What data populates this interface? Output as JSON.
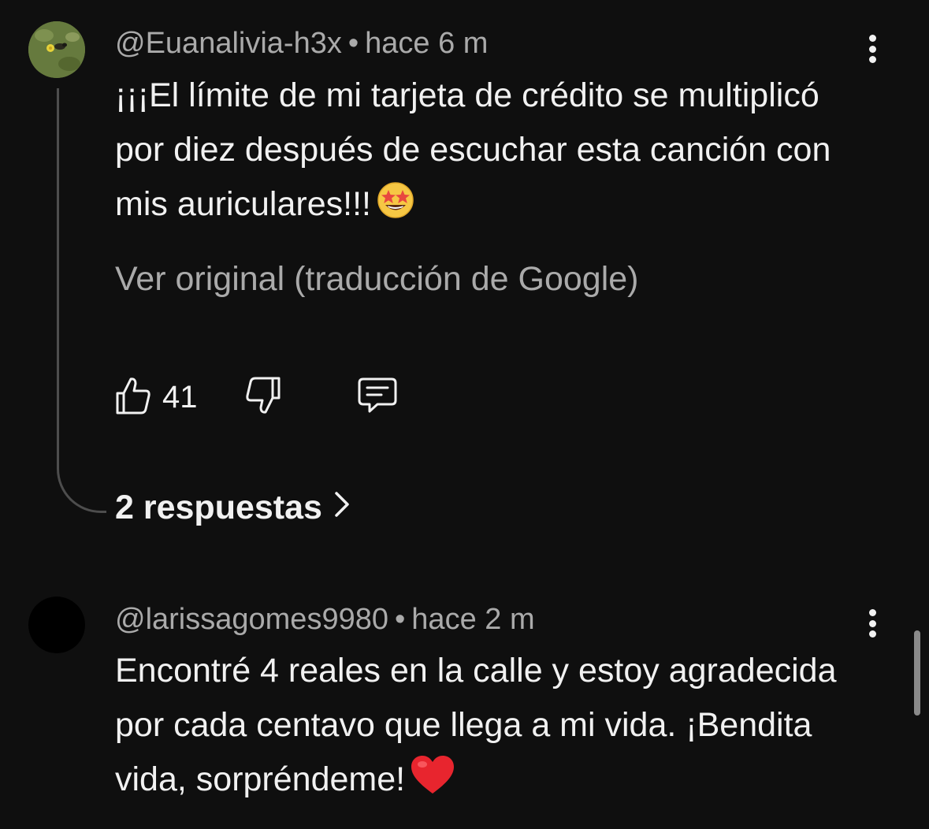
{
  "comments": [
    {
      "author": "@Euanalivia-h3x",
      "time": "hace 6 m",
      "text": "¡¡¡El límite de mi tarjeta de crédito se multiplicó por diez después de escuchar esta canción con mis auriculares!!!",
      "emoji": "star-struck-emoji",
      "translate_label": "Ver original (traducción de Google)",
      "likes": "41",
      "replies_label": "2 respuestas"
    },
    {
      "author": "@larissagomes9980",
      "time": "hace 2 m",
      "text": "Encontré 4 reales en la calle y estoy agradecida por cada centavo que llega a mi vida. ¡Bendita vida, sorpréndeme!",
      "emoji": "red-heart-emoji"
    }
  ],
  "separator": "•",
  "colors": {
    "background": "#0f0f0f",
    "primary_text": "#f1f1f1",
    "secondary_text": "#aaaaaa",
    "thread_line": "#4d4d4d"
  }
}
